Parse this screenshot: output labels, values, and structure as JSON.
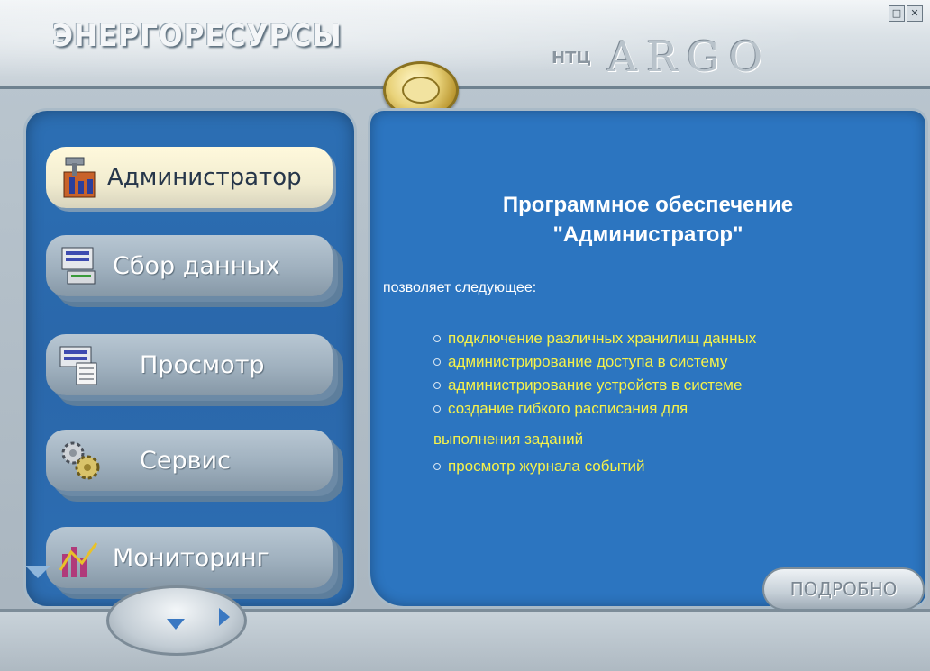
{
  "header": {
    "brand": "ЭНЕРГОРЕСУРСЫ",
    "ntc": "НТЦ",
    "argo": "ARGO",
    "window_buttons": [
      "□",
      "✕"
    ]
  },
  "nav": {
    "items": [
      {
        "label": "Администратор",
        "icon": "admin-icon",
        "active": true
      },
      {
        "label": "Сбор данных",
        "icon": "data-collection-icon",
        "active": false
      },
      {
        "label": "Просмотр",
        "icon": "view-icon",
        "active": false
      },
      {
        "label": "Сервис",
        "icon": "gears-icon",
        "active": false
      },
      {
        "label": "Мониторинг",
        "icon": "monitoring-chart-icon",
        "active": false
      }
    ]
  },
  "content": {
    "title_line1": "Программное обеспечение",
    "title_line2": "\"Администратор\"",
    "intro": "позволяет следующее:",
    "features": [
      "подключение различных хранилищ данных",
      "администрирование доступа в систему",
      "администрирование устройств в системе",
      "создание гибкого расписания для",
      "просмотр журнала событий"
    ],
    "feature_continuation": "выполнения заданий",
    "detail_button": "ПОДРОБНО"
  },
  "colors": {
    "panel_blue": "#2c75c0",
    "feature_yellow": "#f6f24a",
    "frame_grey": "#b9c5ce"
  }
}
